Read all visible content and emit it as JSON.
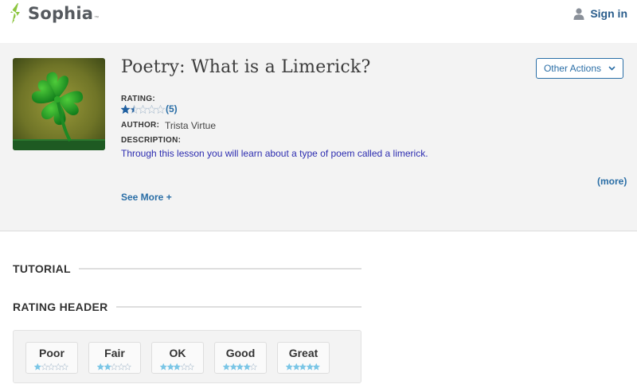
{
  "header": {
    "logo_text": "Sophia",
    "logo_tm": "™",
    "signin_label": "Sign in"
  },
  "lesson": {
    "title": "Poetry: What is a Limerick?",
    "rating_label": "RATING:",
    "rating_value": 1.5,
    "rating_max": 5,
    "rating_count": "(5)",
    "author_label": "AUTHOR:",
    "author": "Trista Virtue",
    "description_label": "DESCRIPTION:",
    "description": "Through this lesson you will learn about a type of poem called a limerick.",
    "more_link": "(more)",
    "see_more": "See More +",
    "thumbnail_icon": "four-leaf-clover"
  },
  "actions": {
    "label": "Other Actions"
  },
  "sections": {
    "tutorial": "TUTORIAL",
    "rating_header": "RATING HEADER"
  },
  "rating_options": [
    {
      "label": "Poor",
      "stars": 1
    },
    {
      "label": "Fair",
      "stars": 2
    },
    {
      "label": "OK",
      "stars": 3
    },
    {
      "label": "Good",
      "stars": 4
    },
    {
      "label": "Great",
      "stars": 5
    }
  ],
  "colors": {
    "brand_green": "#8dc63f",
    "link_blue": "#2a6ea6",
    "star_fill": "#1f5fa0",
    "star_empty": "#b9c8d6",
    "small_star_fill": "#7bc6e6"
  }
}
